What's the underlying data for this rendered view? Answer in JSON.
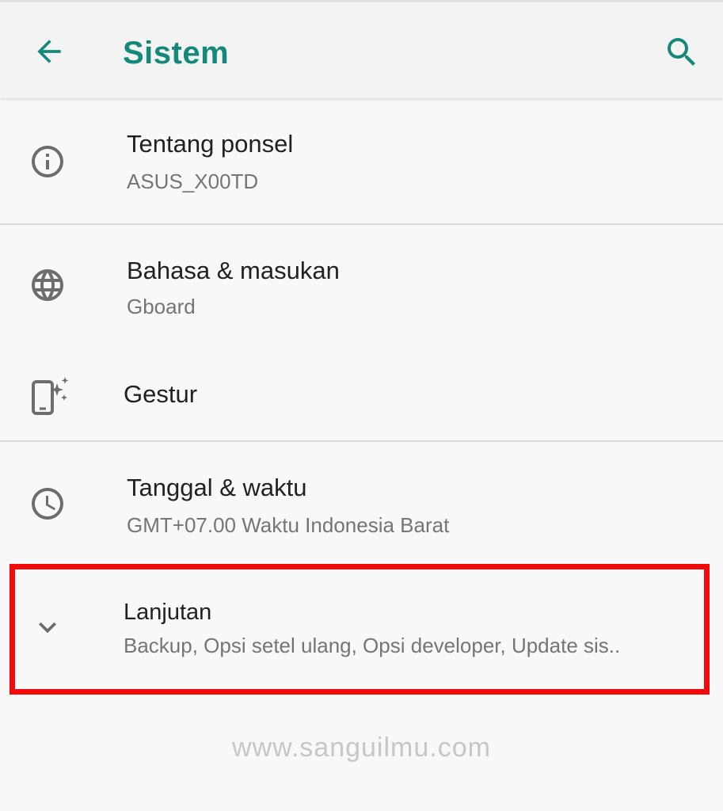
{
  "header": {
    "title": "Sistem",
    "back_icon": "arrow-back-icon",
    "search_icon": "search-icon",
    "accent_color": "#14897a"
  },
  "items": [
    {
      "icon": "info-icon",
      "label": "Tentang ponsel",
      "sub": "ASUS_X00TD"
    },
    {
      "icon": "globe-icon",
      "label": "Bahasa & masukan",
      "sub": "Gboard"
    },
    {
      "icon": "gesture-phone-icon",
      "label": "Gestur"
    },
    {
      "icon": "clock-icon",
      "label": "Tanggal & waktu",
      "sub": "GMT+07.00 Waktu Indonesia Barat"
    },
    {
      "icon": "chevron-down-icon",
      "label": "Lanjutan",
      "sub": "Backup, Opsi setel ulang, Opsi developer, Update sis.."
    }
  ],
  "highlight_color": "#f30b0b",
  "watermark": "www.sanguilmu.com"
}
